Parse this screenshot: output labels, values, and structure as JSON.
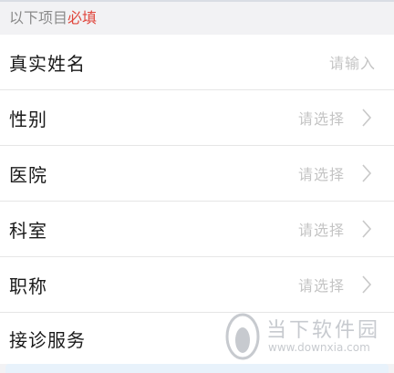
{
  "header": {
    "prefix": "以下项目",
    "required": "必填"
  },
  "form": {
    "rows": [
      {
        "label": "真实姓名",
        "placeholder": "请输入",
        "chevron": false
      },
      {
        "label": "性别",
        "placeholder": "请选择",
        "chevron": true
      },
      {
        "label": "医院",
        "placeholder": "请选择",
        "chevron": true
      },
      {
        "label": "科室",
        "placeholder": "请选择",
        "chevron": true
      },
      {
        "label": "职称",
        "placeholder": "请选择",
        "chevron": true
      },
      {
        "label": "接诊服务"
      }
    ]
  },
  "watermark": {
    "title": "当下软件园",
    "url": "www.downxia.com"
  },
  "colors": {
    "required": "#e0463c",
    "label": "#1a1a1a",
    "placeholder": "#c4c4c4",
    "background": "#f2f2f4"
  },
  "icons": {
    "chevron": "chevron-right-icon",
    "watermark_logo": "watermark-logo-icon"
  }
}
